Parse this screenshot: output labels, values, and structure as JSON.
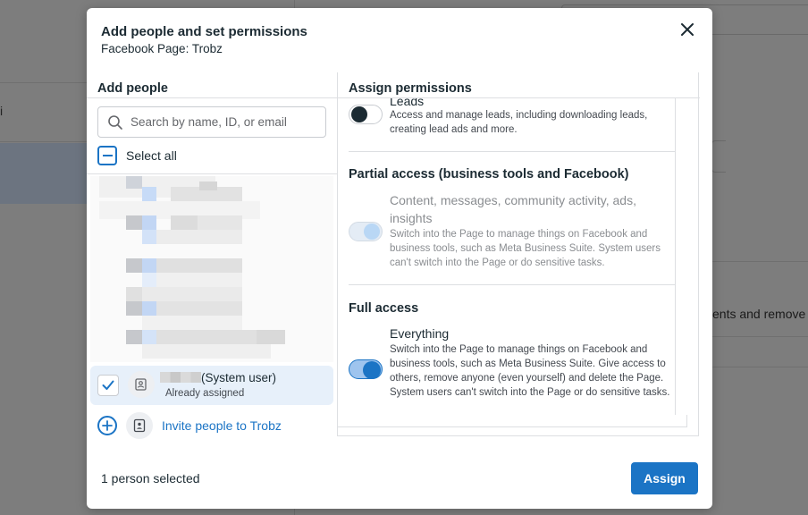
{
  "background": {
    "left_letter": "i",
    "right_text": "ents and remove t"
  },
  "modal": {
    "title": "Add people and set permissions",
    "subtitle": "Facebook Page: Trobz",
    "close_icon": "close-icon"
  },
  "left_panel": {
    "heading": "Add people",
    "search": {
      "placeholder": "Search by name, ID, or email",
      "value": ""
    },
    "select_all_label": "Select all",
    "selected_user": {
      "name_suffix": "(System user)",
      "status": "Already assigned",
      "checked": true
    },
    "invite_label": "Invite people to Trobz"
  },
  "right_panel": {
    "heading": "Assign permissions",
    "leads": {
      "name": "Leads",
      "description": "Access and manage leads, including downloading leads, creating lead ads and more.",
      "enabled": false
    },
    "partial": {
      "section_title": "Partial access (business tools and Facebook)",
      "name": "Content, messages, community activity, ads, insights",
      "description": "Switch into the Page to manage things on Facebook and business tools, such as Meta Business Suite. System users can't switch into the Page or do sensitive tasks.",
      "enabled": true,
      "disabled": true
    },
    "full": {
      "section_title": "Full access",
      "name": "Everything",
      "description": "Switch into the Page to manage things on Facebook and business tools, such as Meta Business Suite. Give access to others, remove anyone (even yourself) and delete the Page. System users can't switch into the Page or do sensitive tasks.",
      "enabled": true
    }
  },
  "footer": {
    "selected_count": "1 person selected",
    "assign_label": "Assign"
  },
  "colors": {
    "accent": "#1b74c5",
    "selected_row": "#e7f0fa",
    "overlay": "#7f7f7f"
  }
}
